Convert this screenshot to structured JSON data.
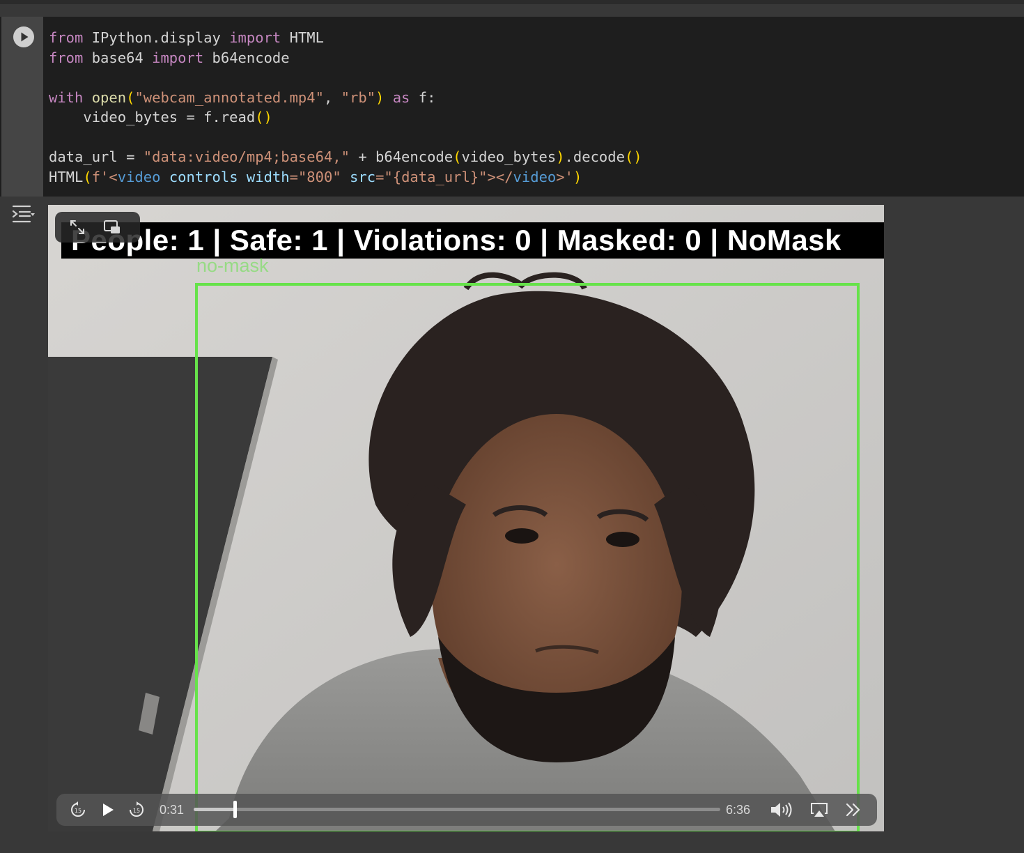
{
  "cell": {
    "code_lines": [
      [
        {
          "t": "from",
          "c": "kw"
        },
        {
          "t": " IPython.display "
        },
        {
          "t": "import",
          "c": "kw"
        },
        {
          "t": " HTML"
        }
      ],
      [
        {
          "t": "from",
          "c": "kw"
        },
        {
          "t": " base64 "
        },
        {
          "t": "import",
          "c": "kw"
        },
        {
          "t": " b64encode"
        }
      ],
      [
        {
          "t": ""
        }
      ],
      [
        {
          "t": "with",
          "c": "kw"
        },
        {
          "t": " "
        },
        {
          "t": "open",
          "c": "fn"
        },
        {
          "t": "(",
          "c": "pr"
        },
        {
          "t": "\"webcam_annotated.mp4\"",
          "c": "st"
        },
        {
          "t": ", "
        },
        {
          "t": "\"rb\"",
          "c": "st"
        },
        {
          "t": ")",
          "c": "pr"
        },
        {
          "t": " "
        },
        {
          "t": "as",
          "c": "kw"
        },
        {
          "t": " f:"
        }
      ],
      [
        {
          "t": "    video_bytes = f.read"
        },
        {
          "t": "()",
          "c": "pr"
        }
      ],
      [
        {
          "t": ""
        }
      ],
      [
        {
          "t": "data_url = "
        },
        {
          "t": "\"data:video/mp4;base64,\"",
          "c": "st"
        },
        {
          "t": " + b64encode"
        },
        {
          "t": "(",
          "c": "pr"
        },
        {
          "t": "video_bytes"
        },
        {
          "t": ")",
          "c": "pr"
        },
        {
          "t": ".decode"
        },
        {
          "t": "()",
          "c": "pr"
        }
      ],
      [
        {
          "t": "HTML"
        },
        {
          "t": "(",
          "c": "pr"
        },
        {
          "t": "f'",
          "c": "st"
        },
        {
          "t": "<",
          "c": "st"
        },
        {
          "t": "video",
          "c": "tg"
        },
        {
          "t": " "
        },
        {
          "t": "controls",
          "c": "at"
        },
        {
          "t": " "
        },
        {
          "t": "width",
          "c": "at"
        },
        {
          "t": "=",
          "c": "st"
        },
        {
          "t": "\"800\"",
          "c": "st"
        },
        {
          "t": " "
        },
        {
          "t": "src",
          "c": "at"
        },
        {
          "t": "=",
          "c": "st"
        },
        {
          "t": "\"{data_url}\"",
          "c": "st"
        },
        {
          "t": "></",
          "c": "st"
        },
        {
          "t": "video",
          "c": "tg"
        },
        {
          "t": ">'",
          "c": "st"
        },
        {
          "t": ")",
          "c": "pr"
        }
      ]
    ]
  },
  "video": {
    "overlay_text": "People: 1 | Safe: 1 | Violations: 0 | Masked: 0 | NoMask",
    "detection_label": "no-mask",
    "current_time": "0:31",
    "duration": "6:36",
    "progress_fraction": 0.078,
    "icons": [
      "fullscreen-icon",
      "picture-in-picture-icon",
      "skip-back-15-icon",
      "play-icon",
      "skip-forward-15-icon",
      "volume-icon",
      "airplay-icon",
      "more-icon"
    ]
  },
  "colors": {
    "detection_box": "#66e24a",
    "cell_background": "#1e1e1e",
    "page_background": "#383838"
  }
}
